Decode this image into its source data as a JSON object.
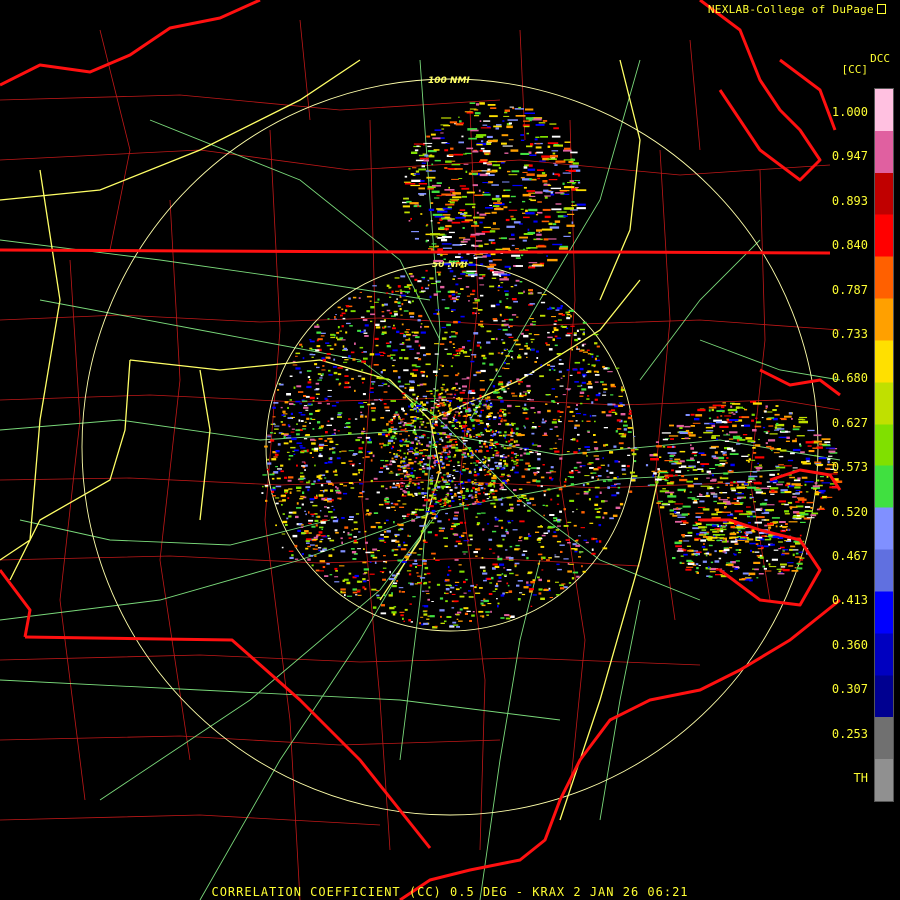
{
  "credit": "NEXLAB-College of DuPage",
  "product": {
    "code": "DCC",
    "unit": "[CC]"
  },
  "title": "CORRELATION COEFFICIENT (CC) 0.5 DEG - KRAX 2 JAN 26 06:21",
  "range_rings": [
    "100 NMI",
    "50 NMI"
  ],
  "legend": {
    "labels": [
      "1.000",
      "0.947",
      "0.893",
      "0.840",
      "0.787",
      "0.733",
      "0.680",
      "0.627",
      "0.573",
      "0.520",
      "0.467",
      "0.413",
      "0.360",
      "0.307",
      "0.253",
      "TH"
    ],
    "colors": [
      "#ffc0e0",
      "#e060a0",
      "#c00000",
      "#ff0000",
      "#ff6000",
      "#ffa000",
      "#ffe000",
      "#c0e000",
      "#80e000",
      "#40e040",
      "#8090ff",
      "#6070e0",
      "#0000ff",
      "#0000c0",
      "#000090",
      "#707070",
      "#909090"
    ]
  },
  "colors": {
    "text": "#ffff33",
    "state_border": "#ff1010",
    "county": "#c01818",
    "highway": "#ffff66",
    "roads": "#90ff90",
    "rings": "#ffffaa"
  }
}
